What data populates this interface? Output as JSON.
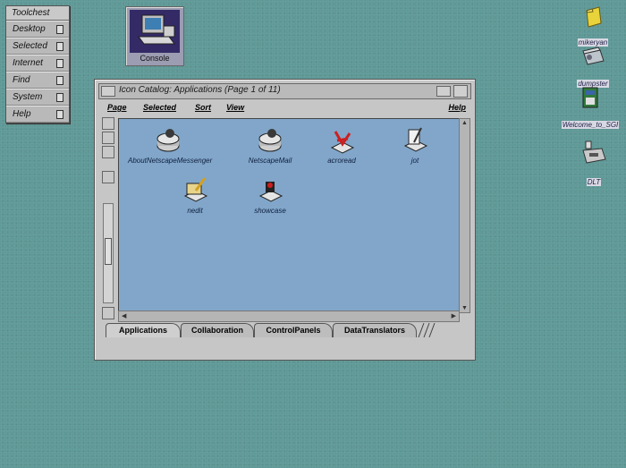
{
  "toolchest": {
    "title": "Toolchest",
    "items": [
      "Desktop",
      "Selected",
      "Internet",
      "Find",
      "System",
      "Help"
    ]
  },
  "console": {
    "label": "Console"
  },
  "desktop_icons": [
    {
      "label": "mikeryan",
      "icon": "folder-icon"
    },
    {
      "label": "dumpster",
      "icon": "dumpster-icon"
    },
    {
      "label": "Welcome_to_SGI",
      "icon": "document-icon"
    },
    {
      "label": "DLT",
      "icon": "tape-drive-icon"
    }
  ],
  "window": {
    "title": "Icon Catalog: Applications (Page 1 of 11)",
    "menu": [
      "Page",
      "Selected",
      "Sort",
      "View",
      "Help"
    ],
    "apps": [
      {
        "label": "AboutNetscapeMessenger",
        "icon": "netscape-disk-icon"
      },
      {
        "label": "NetscapeMail",
        "icon": "netscape-disk-icon"
      },
      {
        "label": "acroread",
        "icon": "acrobat-icon"
      },
      {
        "label": "jot",
        "icon": "notepad-pencil-icon"
      },
      {
        "label": "nedit",
        "icon": "editor-icon"
      },
      {
        "label": "showcase",
        "icon": "showcase-icon"
      }
    ],
    "tabs": [
      "Applications",
      "Collaboration",
      "ControlPanels",
      "DataTranslators"
    ],
    "active_tab": "Applications"
  },
  "colors": {
    "desktop": "#5f9997",
    "pane": "#81a6c9",
    "window": "#c6c6c6"
  }
}
